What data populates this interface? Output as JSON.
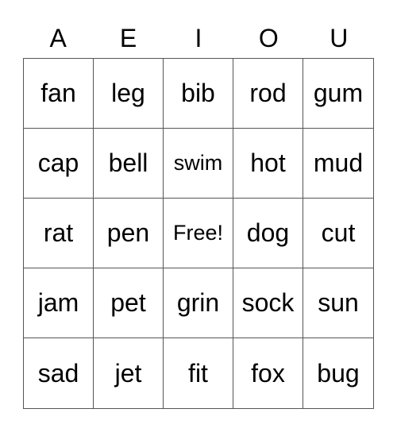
{
  "header": [
    "A",
    "E",
    "I",
    "O",
    "U"
  ],
  "cells": [
    [
      "fan",
      "leg",
      "bib",
      "rod",
      "gum"
    ],
    [
      "cap",
      "bell",
      "swim",
      "hot",
      "mud"
    ],
    [
      "rat",
      "pen",
      "Free!",
      "dog",
      "cut"
    ],
    [
      "jam",
      "pet",
      "grin",
      "sock",
      "sun"
    ],
    [
      "sad",
      "jet",
      "fit",
      "fox",
      "bug"
    ]
  ]
}
